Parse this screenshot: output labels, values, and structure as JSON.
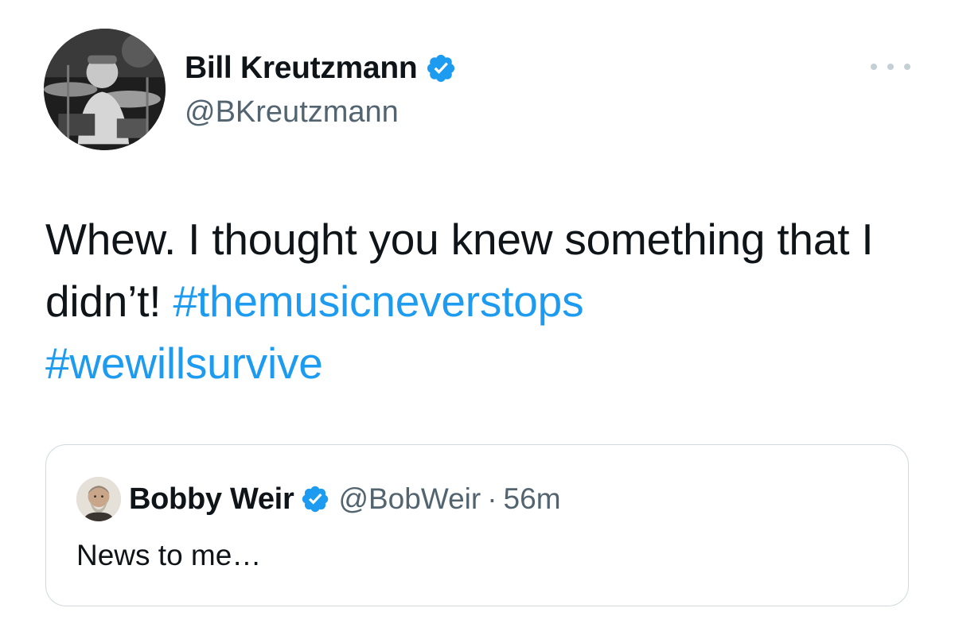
{
  "author": {
    "name": "Bill Kreutzmann",
    "handle": "@BKreutzmann",
    "verified": true,
    "avatar_icon": "drummer-photo"
  },
  "more_icon": "ellipsis-icon",
  "tweet": {
    "text_plain": "Whew. I thought you knew something that I didn’t!",
    "hashtags": [
      "#themusicneverstops",
      "#wewillsurvive"
    ]
  },
  "quoted_tweet": {
    "name": "Bobby Weir",
    "handle": "@BobWeir",
    "separator": "·",
    "time": "56m",
    "verified": true,
    "avatar_icon": "bearded-man-photo",
    "text": "News to me…"
  },
  "colors": {
    "text_primary": "#0f1419",
    "text_secondary": "#536471",
    "link": "#1d9bf0",
    "verified_badge": "#1d9bf0",
    "border": "#cfd9de"
  }
}
